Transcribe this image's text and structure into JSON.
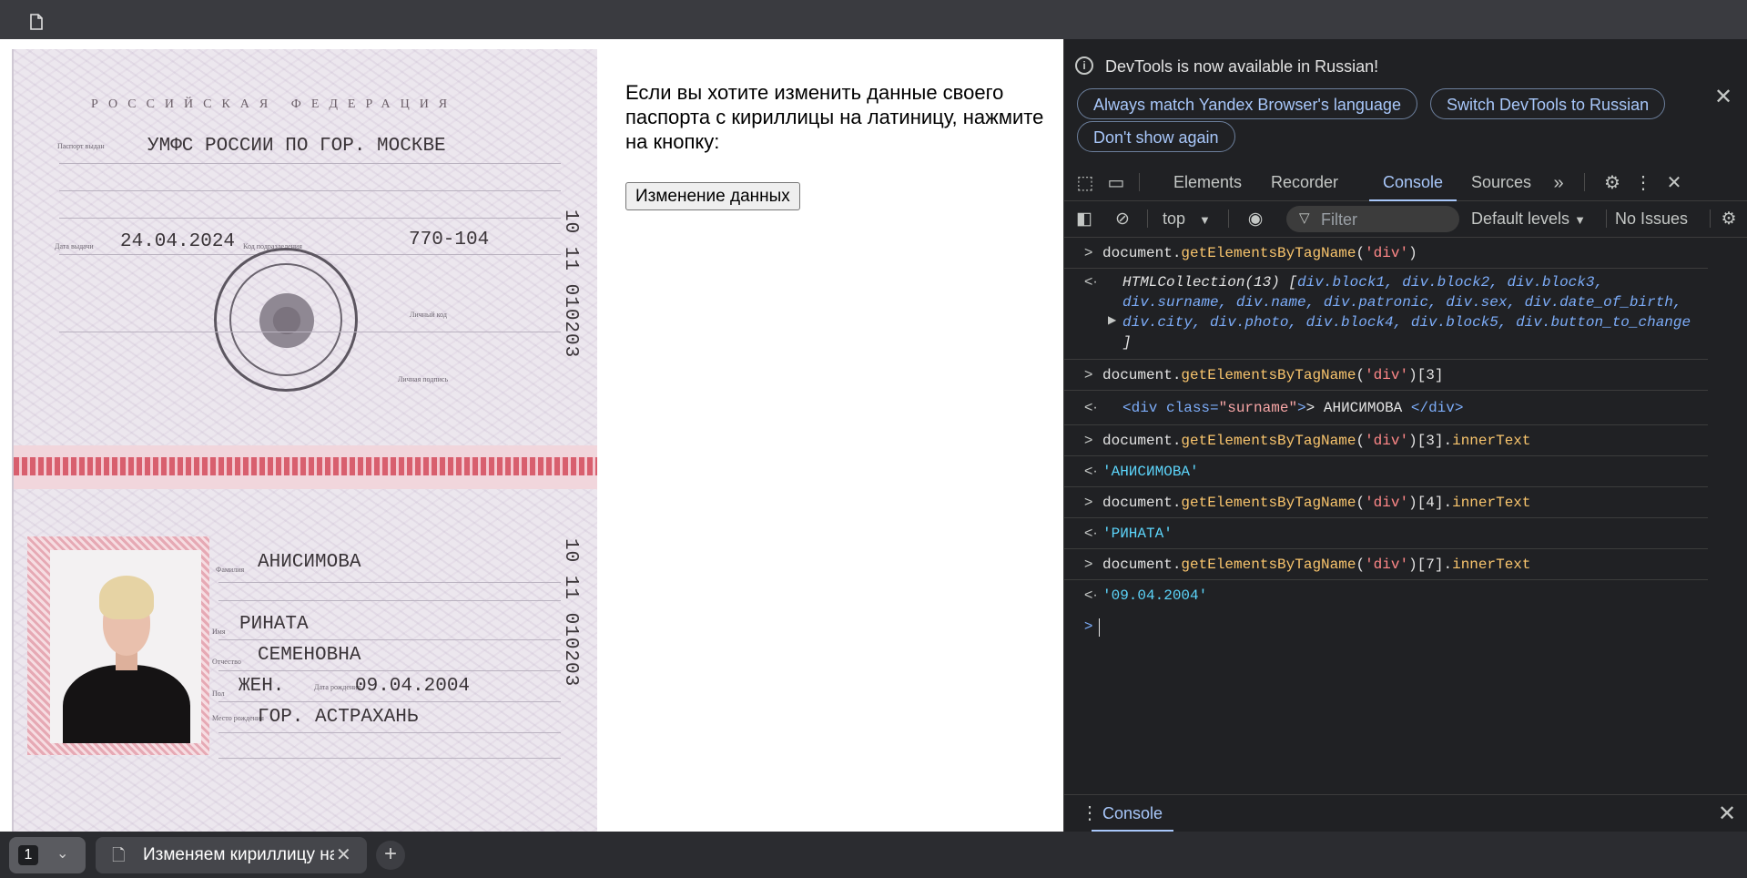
{
  "page": {
    "info_text": "Если вы хотите изменить данные своего паспорта с кириллицы на латиницу, нажмите на кнопку:",
    "button_label": "Изменение данных"
  },
  "passport": {
    "country": "РОССИЙСКАЯ ФЕДЕРАЦИЯ",
    "issued_by": "УМФС РОССИИ ПО ГОР. МОСКВЕ",
    "issue_date": "24.04.2024",
    "division_code": "770-104",
    "serial": "10 11 010203",
    "surname": "АНИСИМОВА",
    "name": "РИНАТА",
    "patronymic": "СЕМЕНОВНА",
    "sex": "ЖЕН.",
    "date_of_birth": "09.04.2004",
    "birth_place": "ГОР. АСТРАХАНЬ"
  },
  "devtools": {
    "banner_title": "DevTools is now available in Russian!",
    "banner_buttons": [
      "Always match Yandex Browser's language",
      "Switch DevTools to Russian",
      "Don't show again"
    ],
    "tabs": [
      "Elements",
      "Recorder",
      "Console",
      "Sources"
    ],
    "active_tab": "Console",
    "toolbar": {
      "context": "top",
      "filter_placeholder": "Filter",
      "levels": "Default levels",
      "issues": "No Issues"
    },
    "drawer_tab": "Console"
  },
  "console": {
    "cmd1": {
      "obj": "document.",
      "method": "getElementsByTagName",
      "open": "(",
      "arg": "'div'",
      "close": ")"
    },
    "res1": {
      "head": "HTMLCollection(13) [",
      "items_line1": "div.block1, div.block2, div.block3,",
      "items_line2": "div.surname, div.name, div.patronic, div.sex, div.date_of_birth,",
      "items_line3": "div.city, div.photo, div.block4, div.block5, div.button_to_change",
      "tail": "]"
    },
    "cmd2": {
      "obj": "document.",
      "method": "getElementsByTagName",
      "open": "(",
      "arg": "'div'",
      "close": ")[3]"
    },
    "res2": {
      "open": "<div class=",
      "cls": "\"surname\"",
      "mid": "> АНИСИМОВА ",
      "close": "</div>"
    },
    "cmd3": {
      "obj": "document.",
      "method": "getElementsByTagName",
      "open": "(",
      "arg": "'div'",
      "close": ")[3].",
      "prop": "innerText"
    },
    "res3": "'АНИСИМОВА'",
    "cmd4": {
      "obj": "document.",
      "method": "getElementsByTagName",
      "open": "(",
      "arg": "'div'",
      "close": ")[4].",
      "prop": "innerText"
    },
    "res4": "'РИНАТА'",
    "cmd5": {
      "obj": "document.",
      "method": "getElementsByTagName",
      "open": "(",
      "arg": "'div'",
      "close": ")[7].",
      "prop": "innerText"
    },
    "res5": "'09.04.2004'"
  },
  "taskbar": {
    "tab_count": "1",
    "tab_title": "Изменяем кириллицу на латиницу"
  }
}
